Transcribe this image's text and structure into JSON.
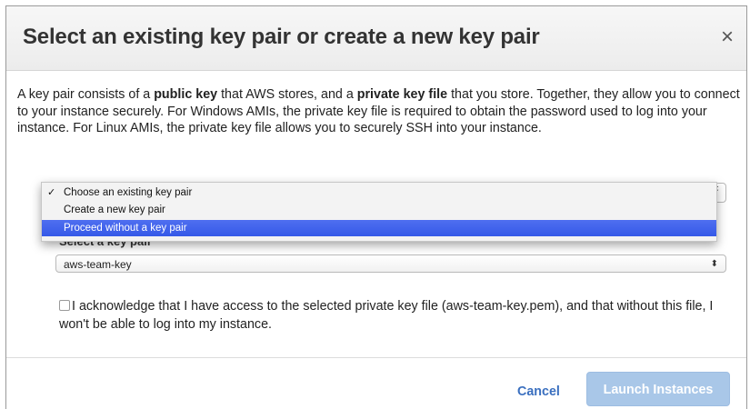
{
  "dialog": {
    "title": "Select an existing key pair or create a new key pair",
    "close_label": "×"
  },
  "description": {
    "part1": "A key pair consists of a ",
    "bold1": "public key",
    "part2": " that AWS stores, and a ",
    "bold2": "private key file",
    "part3": " that you store. Together, they allow you to connect to your instance securely. For Windows AMIs, the private key file is required to obtain the password used to log into your instance. For Linux AMIs, the private key file allows you to securely SSH into your instance."
  },
  "key_pair_action_select": {
    "arrows": "⬍",
    "options": [
      {
        "label": "Choose an existing key pair",
        "checked": true,
        "highlighted": false
      },
      {
        "label": "Create a new key pair",
        "checked": false,
        "highlighted": false
      },
      {
        "label": "Proceed without a key pair",
        "checked": false,
        "highlighted": true
      }
    ],
    "check_mark": "✓"
  },
  "key_pair_select": {
    "label": "Select a key pair",
    "value": "aws-team-key",
    "arrows": "⬍"
  },
  "acknowledge": {
    "checked": false,
    "text": "I acknowledge that I have access to the selected private key file (aws-team-key.pem), and that without this file, I won't be able to log into my instance."
  },
  "footer": {
    "cancel_label": "Cancel",
    "launch_label": "Launch Instances"
  },
  "colors": {
    "accent": "#3a6fbf",
    "selected_option": "#3559e8",
    "launch_disabled": "#a9c7e8"
  }
}
